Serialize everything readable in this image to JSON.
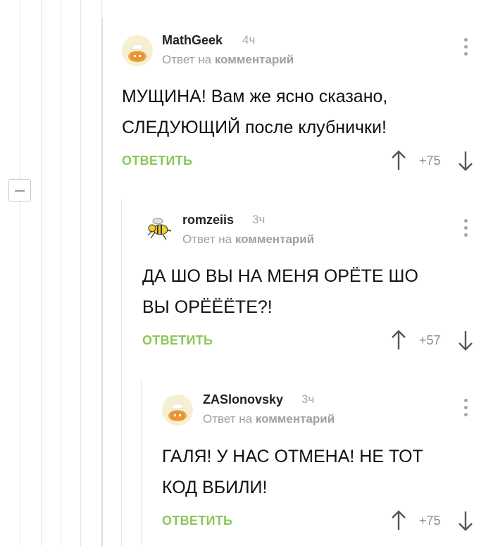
{
  "colors": {
    "reply": "#8ac858",
    "muted": "#a0a0a0",
    "line": "#e4e4e4"
  },
  "comments": [
    {
      "username": "MathGeek",
      "time": "4ч",
      "reply_prefix": "Ответ на",
      "reply_link": "комментарий",
      "body_lines": [
        "МУЩИНА! Вам же ясно сказано,",
        "СЛЕДУЮЩИЙ после клубнички!"
      ],
      "reply_label": "ОТВЕТИТЬ",
      "rating": "+75",
      "avatar_icon": "chef-bread-icon"
    },
    {
      "username": "romzeiis",
      "time": "3ч",
      "reply_prefix": "Ответ на",
      "reply_link": "комментарий",
      "body_lines": [
        "ДА ШО ВЫ НА МЕНЯ ОРЁТЕ ШО",
        "ВЫ ОРЁЁЁТЕ?!"
      ],
      "reply_label": "ОТВЕТИТЬ",
      "rating": "+57",
      "avatar_icon": "wasp-icon"
    },
    {
      "username": "ZASlonovsky",
      "time": "3ч",
      "reply_prefix": "Ответ на",
      "reply_link": "комментарий",
      "body_lines": [
        "ГАЛЯ! У НАС ОТМЕНА! НЕ ТОТ",
        "КОД ВБИЛИ!"
      ],
      "reply_label": "ОТВЕТИТЬ",
      "rating": "+75",
      "avatar_icon": "chef-bread-icon"
    }
  ]
}
